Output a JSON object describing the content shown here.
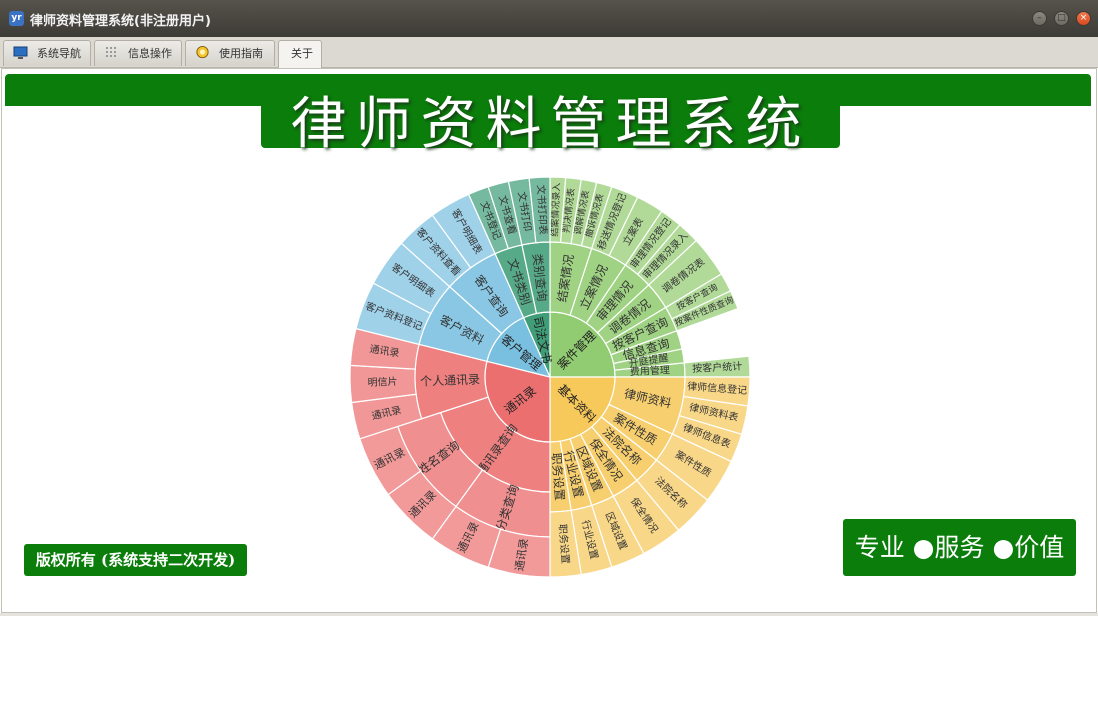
{
  "window": {
    "title": "律师资料管理系统(非注册用户)",
    "app_icon_text": "yr",
    "minimize_icon": "minimize-icon",
    "maximize_icon": "maximize-icon",
    "close_icon": "close-icon"
  },
  "tabs": [
    {
      "label": "系统导航",
      "icon": "monitor-icon",
      "active": false
    },
    {
      "label": "信息操作",
      "icon": "grid-icon",
      "active": false
    },
    {
      "label": "使用指南",
      "icon": "guide-icon",
      "active": false
    },
    {
      "label": "关于",
      "icon": "",
      "active": true
    }
  ],
  "header": {
    "title": "律师资料管理系统"
  },
  "footer": {
    "copyright": "版权所有 (系统支持二次开发)",
    "slogan": "专业 ●服务 ●价值"
  },
  "colors": {
    "brand_green": "#0a7d0a",
    "case": "#92cc72",
    "basic": "#f7c85a",
    "contacts": "#ec6f6f",
    "clients": "#79bfe0",
    "judicial": "#3f9e78"
  },
  "chart_data": {
    "type": "sunburst",
    "groups": [
      {
        "name": "案件管理",
        "color": "#92cc72",
        "start": -90,
        "end": 0,
        "children": [
          {
            "name": "结案情况",
            "start": -90,
            "end": -72,
            "leaves": [
              "结案情况录入",
              "判决情况表",
              "调解情况表",
              "撤诉情况表"
            ]
          },
          {
            "name": "立案情况",
            "start": -72,
            "end": -56,
            "leaves": [
              "移送情况登记",
              "立案表"
            ]
          },
          {
            "name": "审理情况",
            "start": -56,
            "end": -43,
            "leaves": [
              "审理情况登记",
              "审理情况录入"
            ]
          },
          {
            "name": "调卷情况",
            "start": -43,
            "end": -31,
            "leaves": [
              "调卷情况表"
            ]
          },
          {
            "name": "按客户查询",
            "start": -31,
            "end": -20,
            "leaves": [
              "按客户查询",
              "按案件性质查询"
            ]
          },
          {
            "name": "信息查询",
            "start": -20,
            "end": -12,
            "leaves": []
          },
          {
            "name": "开庭提醒",
            "start": -12,
            "end": -6,
            "leaves": []
          },
          {
            "name": "费用管理",
            "start": -6,
            "end": 0,
            "leaves": [
              "按客户统计"
            ]
          }
        ]
      },
      {
        "name": "基本资料",
        "color": "#f7c85a",
        "start": 0,
        "end": 90,
        "children": [
          {
            "name": "律师资料",
            "start": 0,
            "end": 25,
            "leaves": [
              "律师信息登记",
              "律师资料表",
              "律师信息表"
            ]
          },
          {
            "name": "案件性质",
            "start": 25,
            "end": 38,
            "leaves": [
              "案件性质"
            ]
          },
          {
            "name": "法院名称",
            "start": 38,
            "end": 50,
            "leaves": [
              "法院名称"
            ]
          },
          {
            "name": "保全情况",
            "start": 50,
            "end": 62,
            "leaves": [
              "保全情况"
            ]
          },
          {
            "name": "区域设置",
            "start": 62,
            "end": 72,
            "leaves": [
              "区域设置"
            ]
          },
          {
            "name": "行业设置",
            "start": 72,
            "end": 81,
            "leaves": [
              "行业设置"
            ]
          },
          {
            "name": "职务设置",
            "start": 81,
            "end": 90,
            "leaves": [
              "职务设置"
            ]
          }
        ]
      },
      {
        "name": "通讯录",
        "color": "#ec6f6f",
        "start": 90,
        "end": 194,
        "children": [
          {
            "name": "通讯录查询",
            "start": 90,
            "end": 162,
            "sub": [
              {
                "name": "分类查询",
                "start": 90,
                "end": 126,
                "leaves": [
                  "通讯录",
                  "通讯录"
                ]
              },
              {
                "name": "姓名查询",
                "start": 126,
                "end": 162,
                "leaves": [
                  "通讯录",
                  "通讯录"
                ]
              }
            ]
          },
          {
            "name": "个人通讯录",
            "start": 162,
            "end": 194,
            "leaves": [
              "通讯录",
              "明信片",
              "通讯录"
            ]
          }
        ]
      },
      {
        "name": "客户管理",
        "color": "#79bfe0",
        "start": 194,
        "end": 246,
        "children": [
          {
            "name": "客户资料",
            "start": 194,
            "end": 222,
            "leaves": [
              "客户资料登记",
              "客户明细表"
            ]
          },
          {
            "name": "客户查询",
            "start": 222,
            "end": 246,
            "leaves": [
              "客户资料查看",
              "客户明细表"
            ]
          }
        ]
      },
      {
        "name": "司法文书",
        "color": "#3f9e78",
        "start": 246,
        "end": 270,
        "children": [
          {
            "name": "文书类别",
            "start": 246,
            "end": 258,
            "leaves": [
              "文书登记",
              "文书查看"
            ]
          },
          {
            "name": "类别查询",
            "start": 258,
            "end": 270,
            "leaves": [
              "文书打印",
              "文书打印表"
            ]
          }
        ]
      }
    ]
  }
}
